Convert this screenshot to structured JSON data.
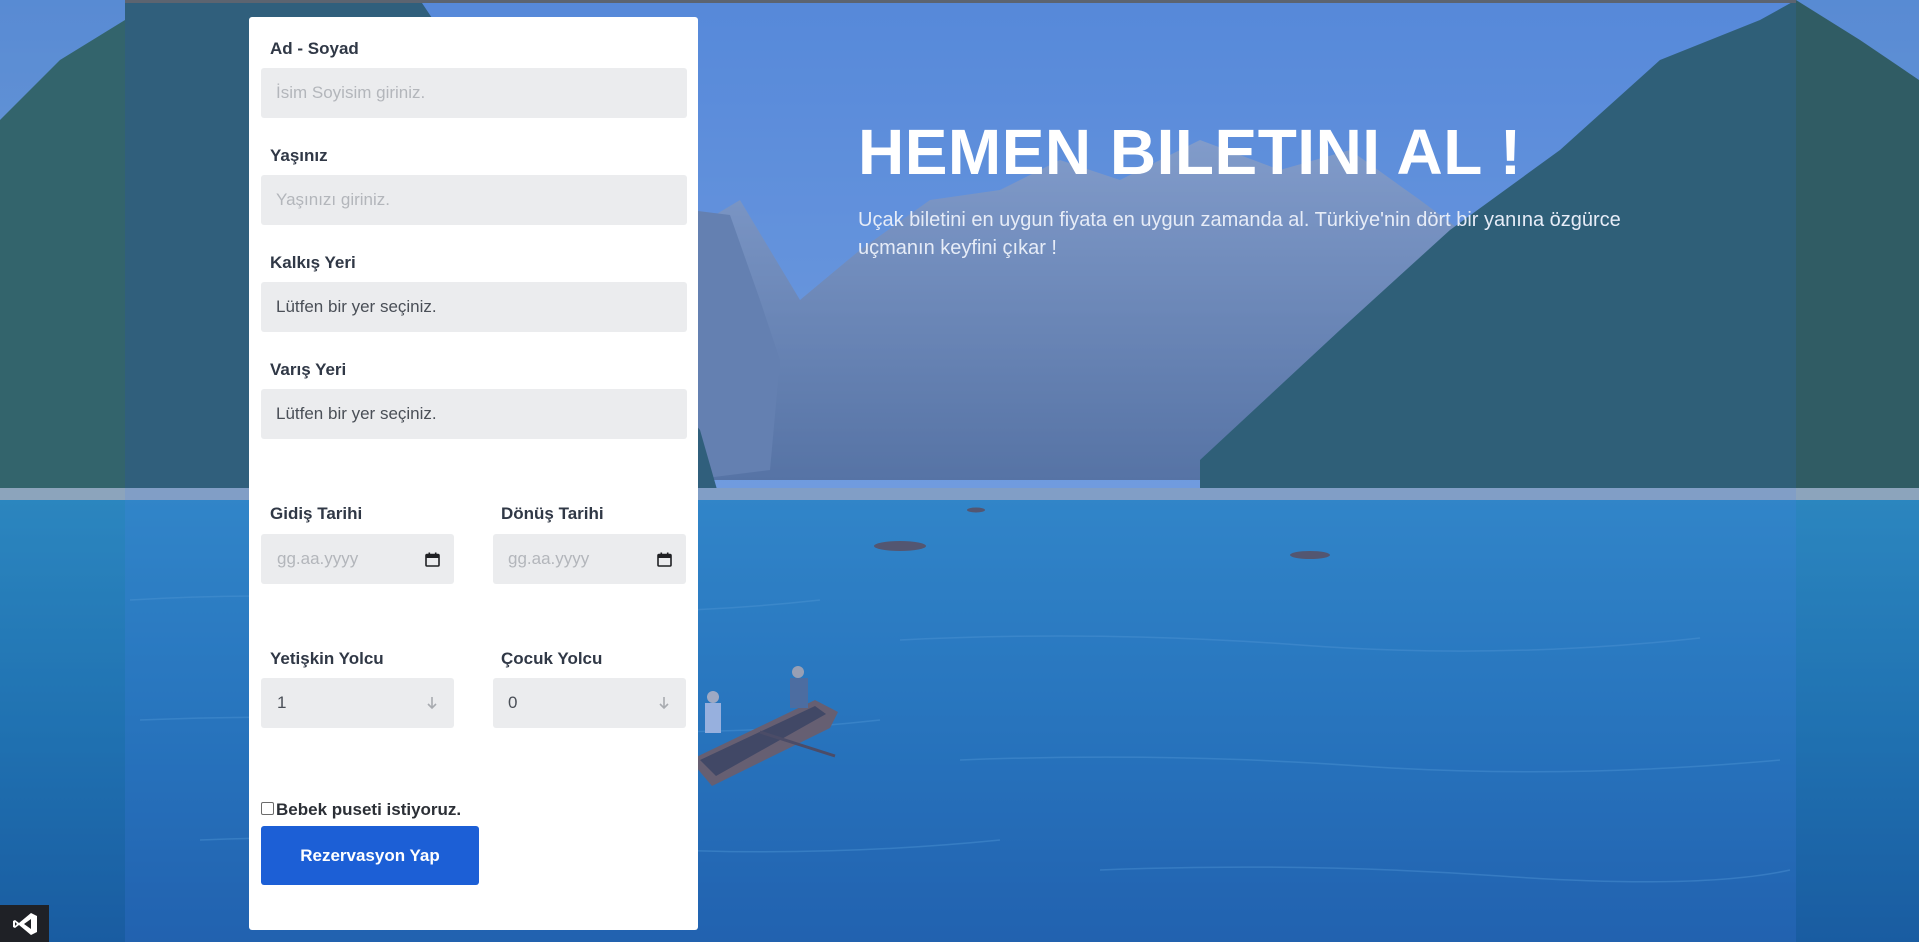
{
  "hero": {
    "title": "HEMEN BILETINI AL !",
    "text": "Uçak biletini en uygun fiyata en uygun zamanda al. Türkiye'nin dört bir yanına özgürce uçmanın keyfini çıkar !"
  },
  "form": {
    "name": {
      "label": "Ad - Soyad",
      "placeholder": "İsim Soyisim giriniz."
    },
    "age": {
      "label": "Yaşınız",
      "placeholder": "Yaşınızı giriniz."
    },
    "departure": {
      "label": "Kalkış Yeri",
      "value": "Lütfen bir yer seçiniz."
    },
    "arrival": {
      "label": "Varış Yeri",
      "value": "Lütfen bir yer seçiniz."
    },
    "departure_date": {
      "label": "Gidiş Tarihi",
      "placeholder": "gg.aa.yyyy"
    },
    "return_date": {
      "label": "Dönüş Tarihi",
      "placeholder": "gg.aa.yyyy"
    },
    "adult": {
      "label": "Yetişkin Yolcu",
      "value": "1"
    },
    "child": {
      "label": "Çocuk Yolcu",
      "value": "0"
    },
    "stroller": {
      "label": "Bebek puseti istiyoruz.",
      "checked": false
    },
    "submit_label": "Rezervasyon Yap"
  },
  "icons": {
    "calendar": "calendar-icon",
    "select_arrow": "arrow-down-icon",
    "app_badge": "visual-studio-icon"
  },
  "colors": {
    "button": "#1c5fd6",
    "card": "#ffffff",
    "input_bg": "#ebecee",
    "overlay": "#3466c8"
  }
}
